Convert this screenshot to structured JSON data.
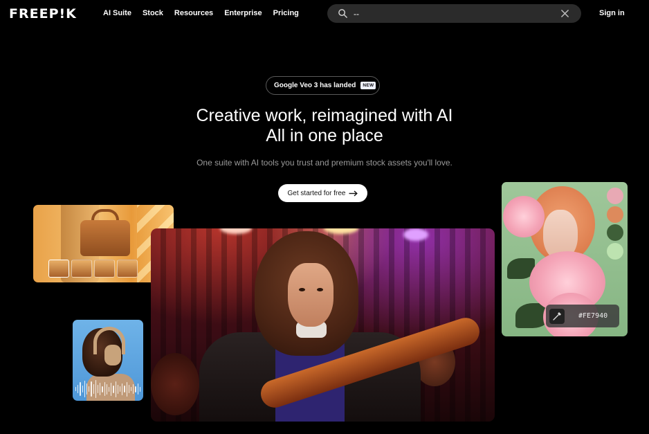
{
  "header": {
    "logo": "FREEP!K",
    "nav": [
      "AI Suite",
      "Stock",
      "Resources",
      "Enterprise",
      "Pricing"
    ],
    "search": {
      "value": "--",
      "placeholder": ""
    },
    "signin_label": "Sign in"
  },
  "hero": {
    "announcement": {
      "text": "Google Veo 3 has landed",
      "badge": "NEW"
    },
    "title_line1": "Creative work, reimagined with AI",
    "title_line2": "All in one place",
    "subtitle": "One suite with AI tools you trust and premium stock assets you'll love.",
    "cta_label": "Get started for free"
  },
  "color_card": {
    "hex": "#FE7940",
    "swatches": [
      "#e8a9b4",
      "#dd8a5c",
      "#3e5f38",
      "#bde3b0"
    ]
  },
  "colors": {
    "background": "#000000",
    "search_bg": "#2b2b2b",
    "accent_text": "#ffffff",
    "muted_text": "#9a9a9a"
  },
  "icons": {
    "search": "search-icon",
    "clear": "close-icon",
    "arrow": "arrow-right-icon",
    "picker": "eyedropper-icon"
  }
}
